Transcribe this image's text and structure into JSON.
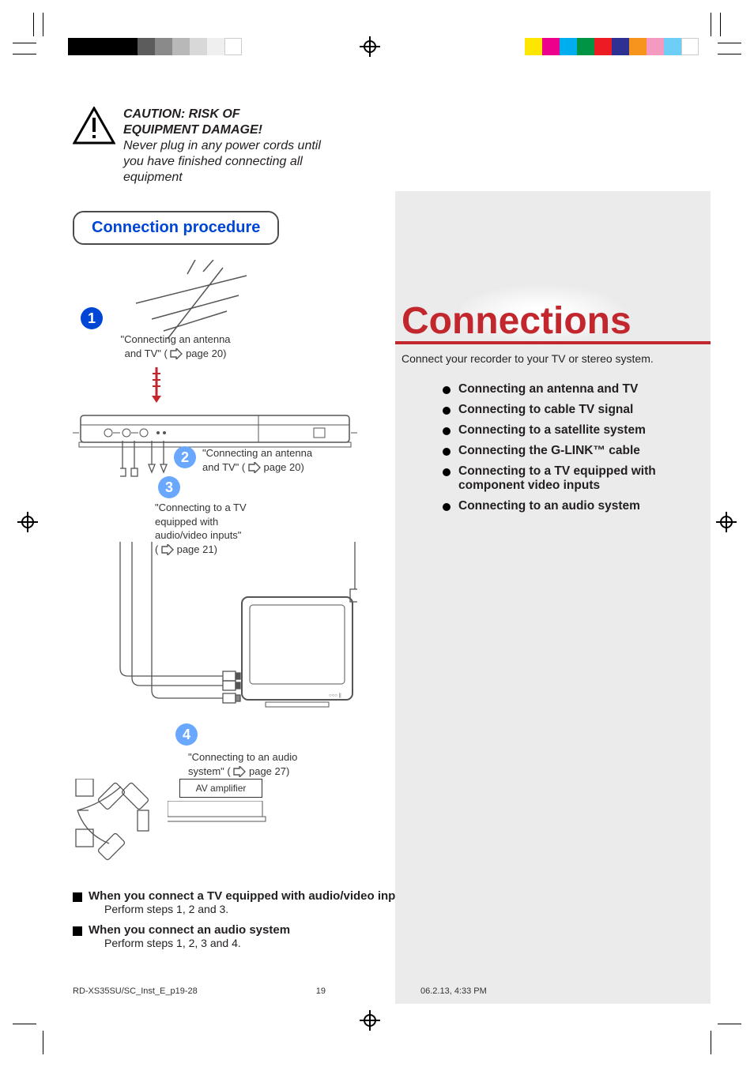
{
  "caution": {
    "title1": "CAUTION: RISK OF",
    "title2": "EQUIPMENT DAMAGE!",
    "body": "Never plug in any power cords until you have finished connecting all equipment"
  },
  "procedure": {
    "heading": "Connection procedure",
    "step1": {
      "num": "1",
      "text1": "\"Connecting an antenna",
      "text2": "and TV\" (",
      "page": " page 20)"
    },
    "step2": {
      "num": "2",
      "text1": "\"Connecting an antenna",
      "text2": "and TV\" (",
      "page": " page 20)"
    },
    "step3": {
      "num": "3",
      "text1": "\"Connecting to a TV equipped with audio/video inputs\"",
      "text2": "(",
      "page": " page 21)"
    },
    "step4": {
      "num": "4",
      "text1": "\"Connecting to an audio system\" (",
      "page": " page 27)"
    },
    "av_amp": "AV amplifier"
  },
  "notes": {
    "n1_title": "When you connect a TV equipped with audio/video inputs",
    "n1_body": "Perform steps 1, 2 and 3.",
    "n2_title": "When you connect an audio system",
    "n2_body": "Perform steps 1, 2, 3 and 4."
  },
  "right": {
    "title": "Connections",
    "sub": "Connect your recorder to your TV or stereo system.",
    "toc": [
      "Connecting an antenna and TV",
      "Connecting to cable TV signal",
      "Connecting to a satellite system",
      "Connecting the G-LINK™ cable",
      "Connecting to a TV equipped with component video inputs",
      "Connecting to an audio system"
    ]
  },
  "footer": {
    "file": "RD-XS35SU/SC_Inst_E_p19-28",
    "page": "19",
    "stamp": "06.2.13, 4:33 PM"
  }
}
